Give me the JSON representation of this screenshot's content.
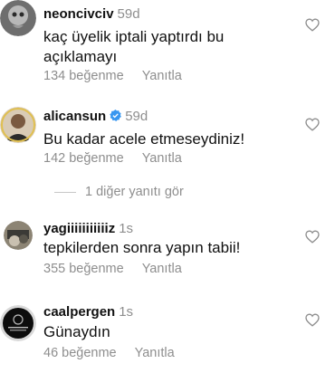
{
  "comments": [
    {
      "username": "neoncivciv",
      "time": "59d",
      "text_line1": "kaç üyelik iptali yaptırdı bu",
      "text_line2": "açıklamayı",
      "likes": "134 beğenme",
      "reply": "Yanıtla"
    },
    {
      "username": "alicansun",
      "time": "59d",
      "text": "Bu kadar acele etmeseydiniz!",
      "likes": "142 beğenme",
      "reply": "Yanıtla"
    },
    {
      "username": "yagiiiiiiiiiiiz",
      "time": "1s",
      "text": "tepkilerden sonra yapın tabii!",
      "likes": "355 beğenme",
      "reply": "Yanıtla"
    },
    {
      "username": "caalpergen",
      "time": "1s",
      "text": "Günaydın",
      "likes": "46 beğenme",
      "reply": "Yanıtla"
    }
  ],
  "more_replies": "1 diğer yanıtı gör",
  "colors": {
    "verified": "#3897f0",
    "secondary_text": "#8e8e8e"
  },
  "icons": {
    "like": "heart-outline-icon",
    "verified": "verified-badge-icon"
  }
}
